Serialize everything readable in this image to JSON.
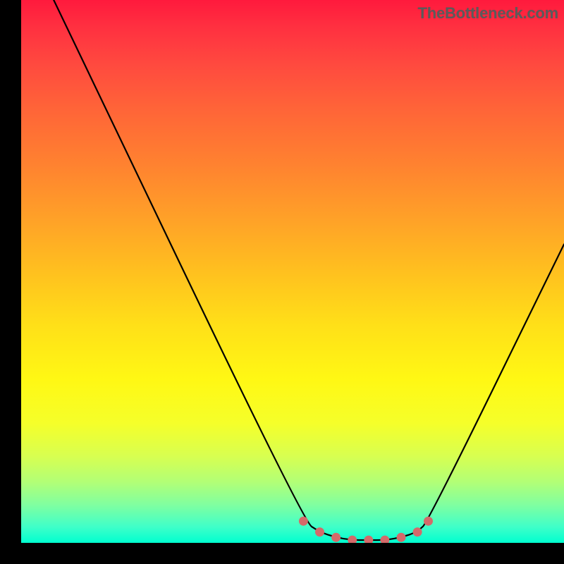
{
  "watermark": "TheBottleneck.com",
  "chart_data": {
    "type": "line",
    "title": "",
    "xlabel": "",
    "ylabel": "",
    "xlim": [
      0,
      100
    ],
    "ylim": [
      0,
      100
    ],
    "grid": false,
    "legend": false,
    "background": "rainbow-gradient",
    "background_stops": [
      {
        "pos": 0,
        "color": "#ff1a3d"
      },
      {
        "pos": 50,
        "color": "#ffe018"
      },
      {
        "pos": 100,
        "color": "#00ffd0"
      }
    ],
    "series": [
      {
        "name": "bottleneck-curve",
        "x": [
          6,
          52,
          55,
          58,
          61,
          64,
          67,
          70,
          73,
          75,
          100
        ],
        "y": [
          100,
          4,
          2,
          1,
          0.5,
          0.5,
          0.5,
          1,
          2,
          4,
          55
        ],
        "color": "#000000"
      }
    ],
    "markers": [
      {
        "x": 52,
        "y": 4,
        "color": "#d46a6a"
      },
      {
        "x": 55,
        "y": 2,
        "color": "#d46a6a"
      },
      {
        "x": 58,
        "y": 1,
        "color": "#d46a6a"
      },
      {
        "x": 61,
        "y": 0.5,
        "color": "#d46a6a"
      },
      {
        "x": 64,
        "y": 0.5,
        "color": "#d46a6a"
      },
      {
        "x": 67,
        "y": 0.5,
        "color": "#d46a6a"
      },
      {
        "x": 70,
        "y": 1,
        "color": "#d46a6a"
      },
      {
        "x": 73,
        "y": 2,
        "color": "#d46a6a"
      },
      {
        "x": 75,
        "y": 4,
        "color": "#d46a6a"
      }
    ]
  }
}
